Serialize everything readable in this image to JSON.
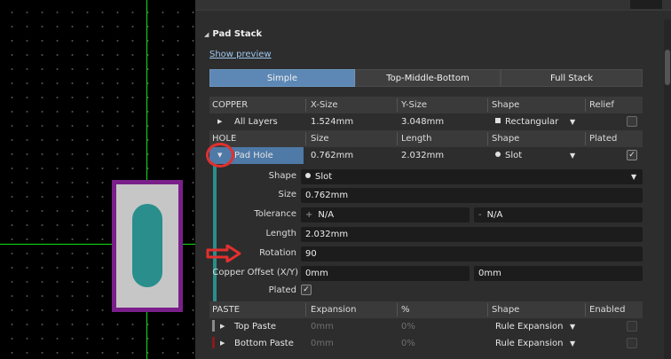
{
  "panel": {
    "section_title": "Pad Stack",
    "section_toggle_icon": "triangle-collapse-icon",
    "show_preview_link": "Show preview",
    "mode_tabs": [
      {
        "label": "Simple",
        "active": true
      },
      {
        "label": "Top-Middle-Bottom",
        "active": false
      },
      {
        "label": "Full Stack",
        "active": false
      }
    ]
  },
  "copper": {
    "headers": [
      "COPPER",
      "X-Size",
      "Y-Size",
      "Shape",
      "Relief"
    ],
    "row": {
      "name": "All Layers",
      "x_size": "1.524mm",
      "y_size": "3.048mm",
      "shape": "Rectangular",
      "relief_checked": false
    }
  },
  "hole": {
    "headers": [
      "HOLE",
      "Size",
      "Length",
      "Shape",
      "Plated"
    ],
    "row": {
      "name": "Pad Hole",
      "size": "0.762mm",
      "length": "2.032mm",
      "shape": "Slot",
      "plated_checked": true
    }
  },
  "hole_detail": {
    "shape_label": "Shape",
    "shape_value": "Slot",
    "size_label": "Size",
    "size_value": "0.762mm",
    "tolerance_label": "Tolerance",
    "tolerance_plus_sign": "+",
    "tolerance_plus": "N/A",
    "tolerance_minus_sign": "-",
    "tolerance_minus": "N/A",
    "length_label": "Length",
    "length_value": "2.032mm",
    "rotation_label": "Rotation",
    "rotation_value": "90",
    "copper_offset_label": "Copper Offset (X/Y)",
    "copper_offset_x": "0mm",
    "copper_offset_y": "0mm",
    "plated_label": "Plated",
    "plated_checked": true
  },
  "paste": {
    "headers": [
      "PASTE",
      "Expansion",
      "%",
      "Shape",
      "Enabled"
    ],
    "rows": [
      {
        "name": "Top Paste",
        "expansion": "0mm",
        "percent": "0%",
        "shape": "Rule Expansion",
        "enabled": false,
        "color": "#8a8a8a"
      },
      {
        "name": "Bottom Paste",
        "expansion": "0mm",
        "percent": "0%",
        "shape": "Rule Expansion",
        "enabled": false,
        "color": "#8b1a1a"
      }
    ]
  },
  "icons": {
    "expander": "triangle-expander-icon",
    "dropdown": "chevron-down-icon",
    "check": "checkmark-icon"
  },
  "colors": {
    "accent_tab": "#5d88b5",
    "annotation": "#e2302e",
    "pad_outline": "#7a1f8a",
    "slot_hole": "#2a8e8c",
    "crosshair": "#16e016"
  }
}
